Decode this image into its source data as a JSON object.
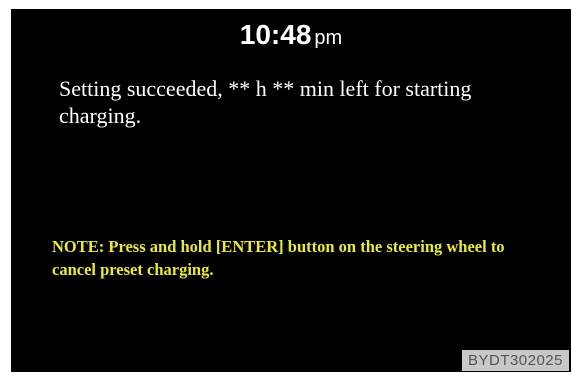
{
  "display": {
    "background_color": "#000000",
    "clock": {
      "time": "10:48",
      "ampm": "pm"
    },
    "message": "Setting succeeded, ** h ** min left for starting charging.",
    "note": "NOTE: Press and hold [ENTER] button on the steering wheel to cancel preset charging.",
    "note_color": "#e9e93a",
    "image_code": "BYDT302025"
  }
}
